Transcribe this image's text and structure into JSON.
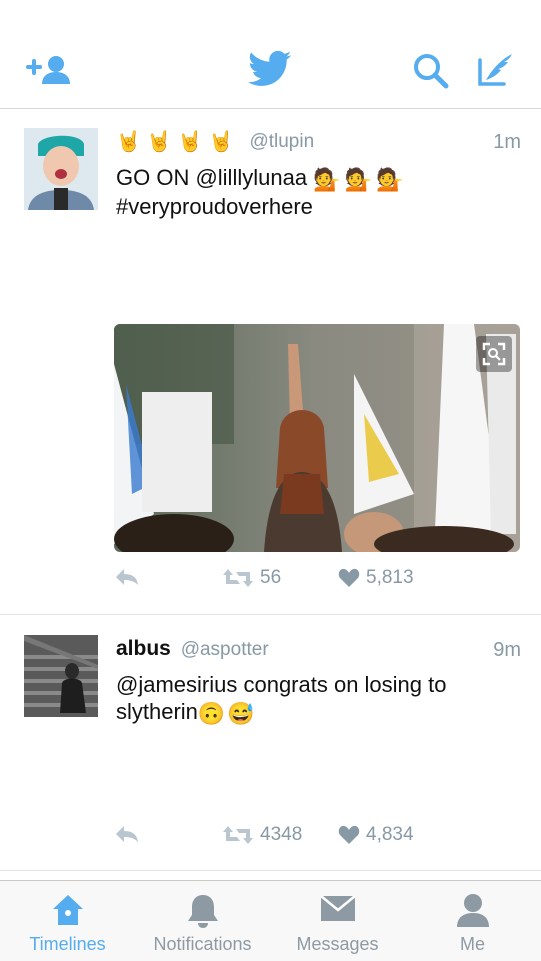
{
  "colors": {
    "accent": "#55acee",
    "muted": "#8899a6",
    "divider": "#e3e3e3"
  },
  "header": {
    "icons": [
      "add-user-icon",
      "twitter-bird-logo",
      "search-icon",
      "compose-tweet-icon"
    ]
  },
  "tweets": [
    {
      "name_emoji": "🤘🤘🤘🤘",
      "handle": "@tlupin",
      "time": "1m",
      "text_line1": "GO ON @lilllylunaa",
      "text_line1_emoji": "💁💁💁",
      "text_line2": "#veryproudoverhere",
      "retweets": "56",
      "likes": "5,813"
    },
    {
      "name": "albus",
      "handle": "@aspotter",
      "time": "9m",
      "text_line1": "@jamesirius congrats on losing to",
      "text_line2": "slytherin",
      "text_line2_emoji": "🙃😅",
      "retweets": "4348",
      "likes": "4,834"
    }
  ],
  "tabbar": {
    "tabs": [
      {
        "label": "Timelines",
        "icon": "home-icon",
        "active": true
      },
      {
        "label": "Notifications",
        "icon": "bell-icon",
        "active": false
      },
      {
        "label": "Messages",
        "icon": "envelope-icon",
        "active": false
      },
      {
        "label": "Me",
        "icon": "person-icon",
        "active": false
      }
    ]
  }
}
